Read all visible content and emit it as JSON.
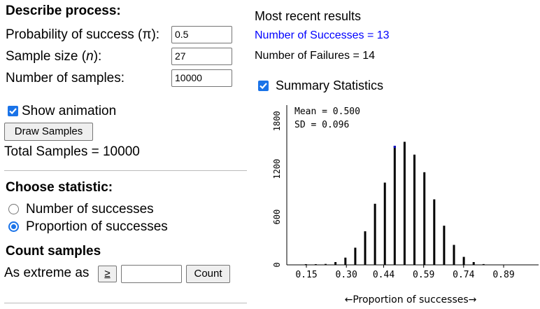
{
  "process": {
    "heading": "Describe process:",
    "prob_label_pre": "Probability of success (",
    "prob_symbol": "π",
    "prob_label_post": "):",
    "prob_value": "0.5",
    "size_label_pre": "Sample size (",
    "size_symbol": "n",
    "size_label_post": "):",
    "size_value": "27",
    "samples_label": "Number of samples:",
    "samples_value": "10000",
    "animation_label": "Show animation",
    "animation_checked": true,
    "draw_button": "Draw Samples",
    "total_text": "Total Samples = 10000"
  },
  "statistic": {
    "heading": "Choose statistic:",
    "options": [
      {
        "label": "Number of successes",
        "selected": false
      },
      {
        "label": "Proportion of successes",
        "selected": true
      }
    ]
  },
  "count": {
    "heading": "Count samples",
    "as_extreme_label": "As extreme as",
    "operator": "≥",
    "value": "",
    "button": "Count"
  },
  "results": {
    "heading": "Most recent results",
    "successes": "Number of Successes = 13",
    "failures": "Number of Failures = 14",
    "summary_label": "Summary Statistics",
    "summary_checked": true,
    "mean_text": "Mean = 0.500",
    "sd_text": "SD = 0.096",
    "successes_color": "#0000ff"
  },
  "chart_data": {
    "type": "bar",
    "xlabel": "←Proportion of successes→",
    "ylabel": "",
    "x_ticks": [
      "0.15",
      "0.30",
      "0.44",
      "0.59",
      "0.74",
      "0.89"
    ],
    "y_ticks": [
      "0",
      "600",
      "1200",
      "1800"
    ],
    "ylim": [
      0,
      2000
    ],
    "highlight_color": "#0000cc",
    "highlight_x": 13,
    "x": [
      4,
      5,
      6,
      7,
      8,
      9,
      10,
      11,
      12,
      13,
      14,
      15,
      16,
      17,
      18,
      19,
      20,
      21,
      22
    ],
    "values": [
      1,
      3,
      11,
      35,
      90,
      215,
      420,
      765,
      1030,
      1490,
      1540,
      1380,
      1160,
      820,
      490,
      250,
      100,
      35,
      10
    ]
  }
}
